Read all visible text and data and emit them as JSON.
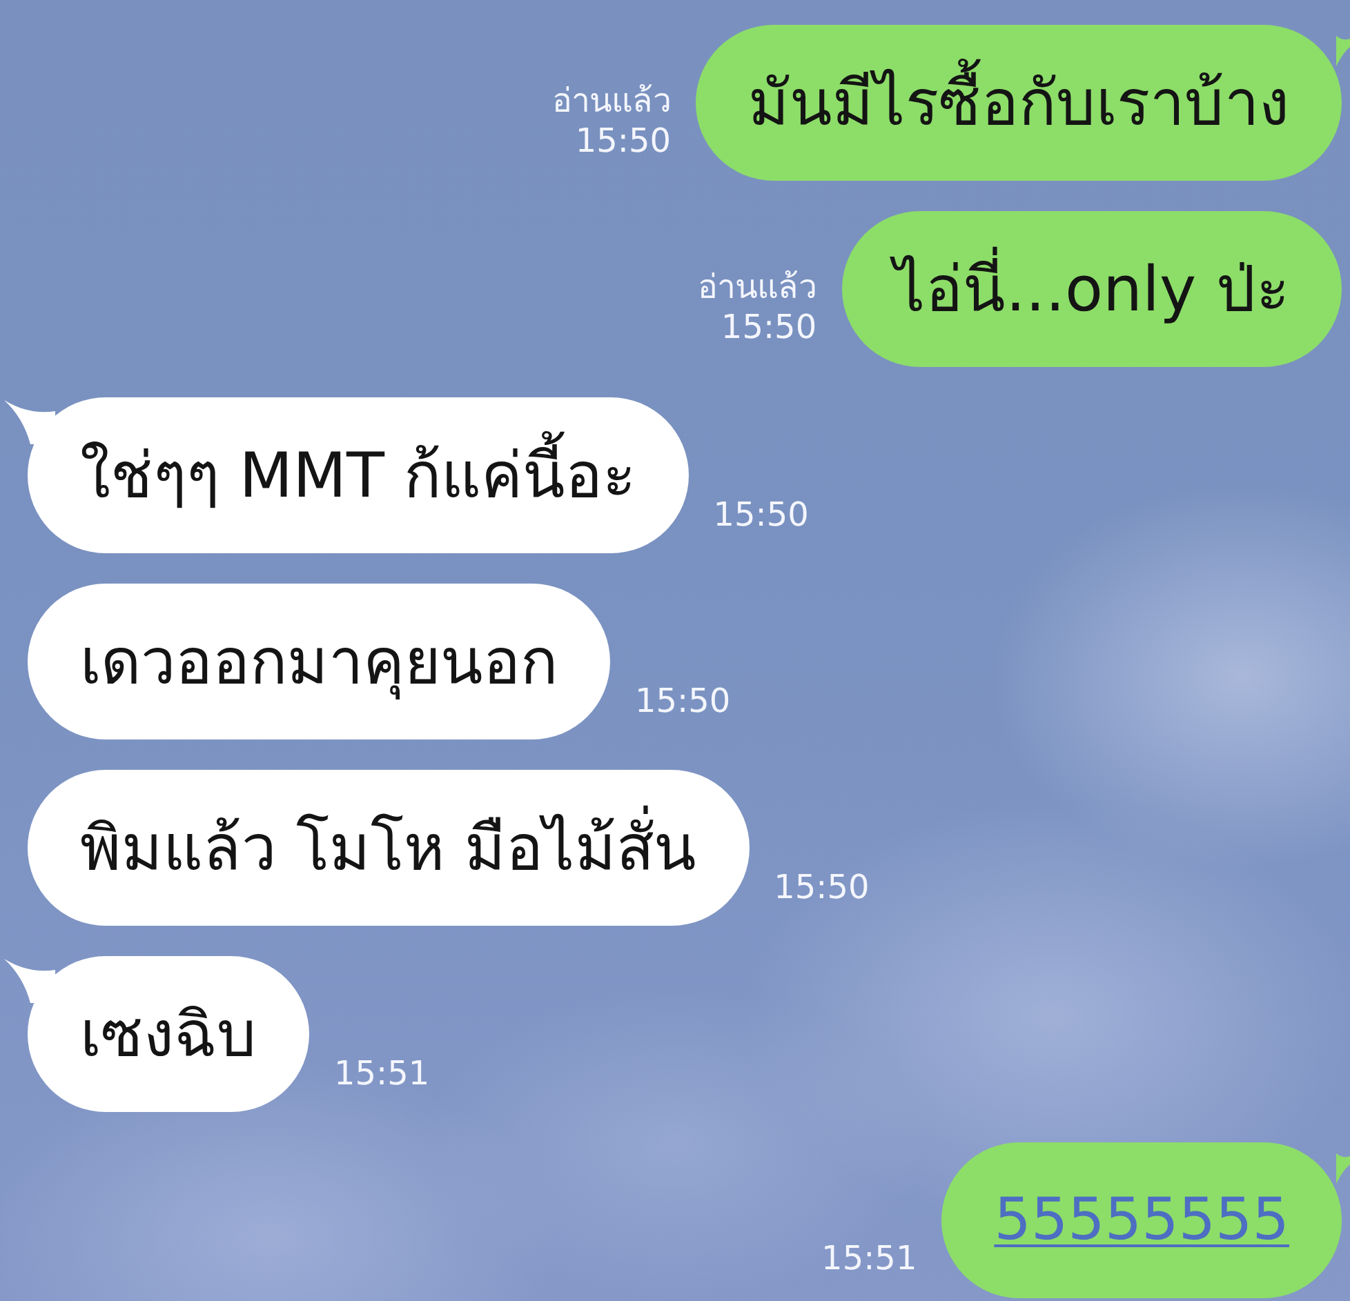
{
  "messages": [
    {
      "kind": "sent",
      "text": "มันมีไรซื้อกับเราบ้าง",
      "read_label": "อ่านแล้ว",
      "time": "15:50",
      "tail": true,
      "link": false
    },
    {
      "kind": "sent",
      "text": "ไอ่นี่...only ป่ะ",
      "read_label": "อ่านแล้ว",
      "time": "15:50",
      "tail": false,
      "link": false
    },
    {
      "kind": "received",
      "text": "ใช่ๆๆ MMT ก้แค่นี้อะ",
      "time": "15:50",
      "tail": true,
      "link": false
    },
    {
      "kind": "received",
      "text": "เดวออกมาคุยนอก",
      "time": "15:50",
      "tail": false,
      "link": false
    },
    {
      "kind": "received",
      "text": "พิมแล้ว โมโห มือไม้สั่น",
      "time": "15:50",
      "tail": false,
      "link": false
    },
    {
      "kind": "received",
      "text": "เซงฉิบ",
      "time": "15:51",
      "tail": true,
      "link": false
    },
    {
      "kind": "sent",
      "text": "55555555",
      "time": "15:51",
      "tail": true,
      "link": true
    }
  ]
}
